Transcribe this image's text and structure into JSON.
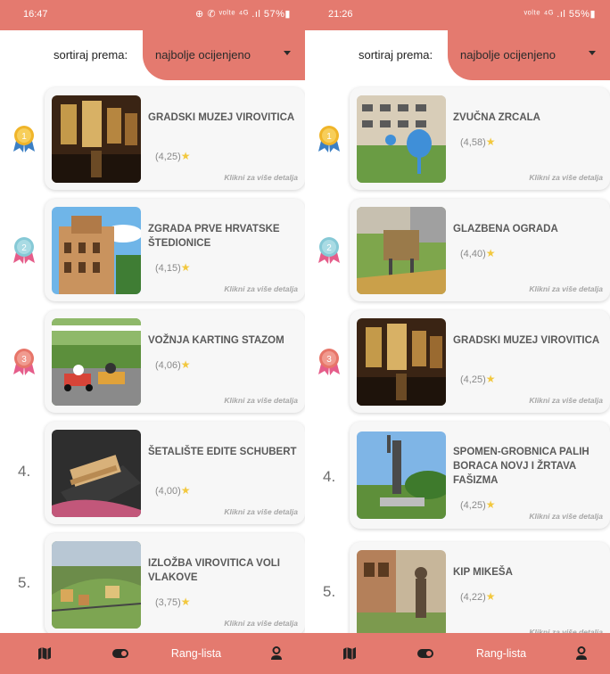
{
  "screens": [
    {
      "status": {
        "time": "16:47",
        "icons": "⊕ ✆ ᵛᵒˡᵗᵉ ⁴ᴳ .ıl 57%▮"
      },
      "sort": {
        "label": "sortiraj prema:",
        "value": "najbolje ocijenjeno"
      },
      "items": [
        {
          "rank": "1",
          "medal": "#f0b52a",
          "title": "GRADSKI MUZEJ VIROVITICA",
          "rating": "(4,25)",
          "more": "Klikni za više detalja"
        },
        {
          "rank": "2",
          "medal": "#86c9d6",
          "title": "ZGRADA PRVE HRVATSKE ŠTEDIONICE",
          "rating": "(4,15)",
          "more": "Klikni za više detalja"
        },
        {
          "rank": "3",
          "medal": "#e77569",
          "title": "VOŽNJA KARTING STAZOM",
          "rating": "(4,06)",
          "more": "Klikni za više detalja"
        },
        {
          "rank": "4.",
          "title": "ŠETALIŠTE EDITE SCHUBERT",
          "rating": "(4,00)",
          "more": "Klikni za više detalja"
        },
        {
          "rank": "5.",
          "title": "IZLOŽBA VIROVITICA VOLI VLAKOVE",
          "rating": "(3,75)",
          "more": "Klikni za više detalja"
        }
      ],
      "nav": {
        "map_icon": "map-icon",
        "toggle_icon": "toggle-icon",
        "rank_label": "Rang-lista",
        "profile_icon": "person-icon"
      }
    },
    {
      "status": {
        "time": "21:26",
        "icons": "ᵛᵒˡᵗᵉ ⁴ᴳ .ıl 55%▮"
      },
      "sort": {
        "label": "sortiraj prema:",
        "value": "najbolje ocijenjeno"
      },
      "items": [
        {
          "rank": "1",
          "medal": "#f0b52a",
          "title": "ZVUČNA ZRCALA",
          "rating": "(4,58)",
          "more": "Klikni za više detalja"
        },
        {
          "rank": "2",
          "medal": "#86c9d6",
          "title": "GLAZBENA OGRADA",
          "rating": "(4,40)",
          "more": "Klikni za više detalja"
        },
        {
          "rank": "3",
          "medal": "#e77569",
          "title": "GRADSKI MUZEJ VIROVITICA",
          "rating": "(4,25)",
          "more": "Klikni za više detalja"
        },
        {
          "rank": "4.",
          "title": "SPOMEN-GROBNICA PALIH BORACA NOVJ I ŽRTAVA FAŠIZMA",
          "rating": "(4,25)",
          "more": "Klikni za više detalja"
        },
        {
          "rank": "5.",
          "title": "KIP MIKEŠA",
          "rating": "(4,22)",
          "more": "Klikni za više detalja"
        }
      ],
      "nav": {
        "map_icon": "map-icon",
        "toggle_icon": "toggle-icon",
        "rank_label": "Rang-lista",
        "profile_icon": "person-icon"
      }
    }
  ],
  "colors": {
    "accent": "#e47a6f",
    "card": "#f7f7f7",
    "title": "#5a5a5a",
    "star": "#f2c83f"
  }
}
